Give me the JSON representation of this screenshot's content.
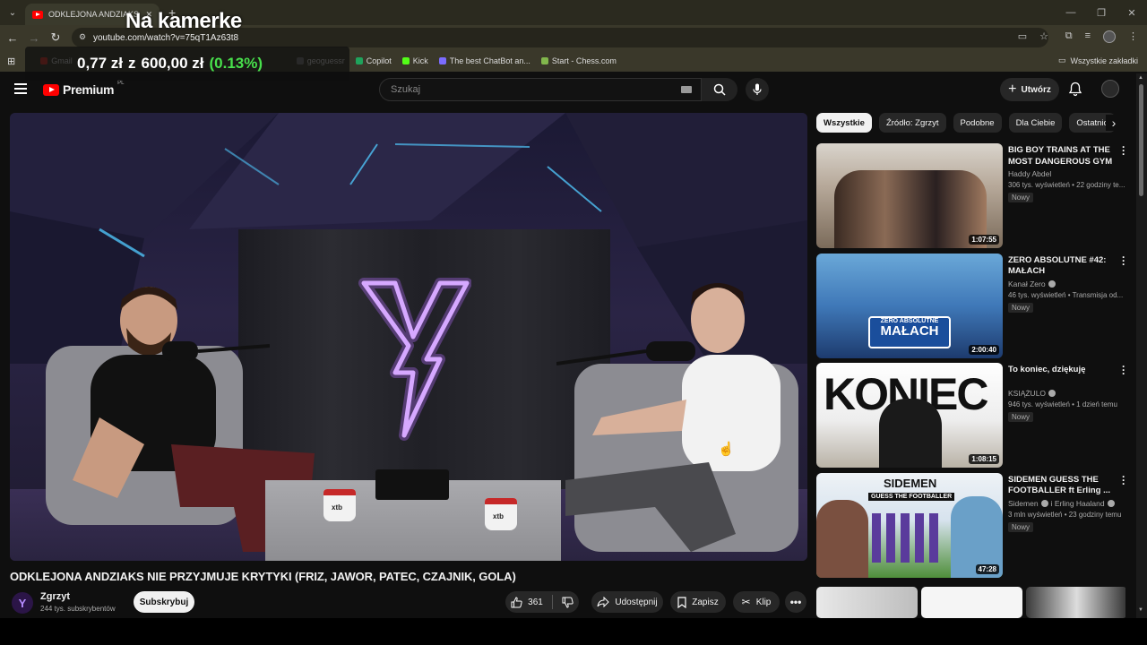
{
  "browser": {
    "tab_title": "ODKLEJONA ANDZIAKS NI",
    "url": "youtube.com/watch?v=75qT1Az63t8",
    "bookmarks": [
      {
        "label": "Gmail",
        "color": "#d93025"
      },
      {
        "label": "geoguessr",
        "color": "#777"
      },
      {
        "label": "Copilot",
        "color": "#1fa35c"
      },
      {
        "label": "Kick",
        "color": "#53fc18"
      },
      {
        "label": "The best ChatBot an...",
        "color": "#7b6cff"
      },
      {
        "label": "Start - Chess.com",
        "color": "#81b64c"
      }
    ],
    "bookmarks_folder": "Wszystkie zakładki"
  },
  "stream_overlay": {
    "camera_label": "Na kamerke",
    "price_current": "0,77 zł",
    "price_connector": "z",
    "price_target": "600,00 zł",
    "price_percent": "(0.13%)"
  },
  "youtube": {
    "logo_text": "Premium",
    "logo_region": "PL",
    "search_placeholder": "Szukaj",
    "create_label": "Utwórz"
  },
  "video": {
    "title": "ODKLEJONA ANDZIAKS NIE PRZYJMUJE KRYTYKI (FRIZ, JAWOR, PATEC, CZAJNIK, GOLA)",
    "channel_name": "Zgrzyt",
    "channel_initial": "Y",
    "channel_subs": "244 tys. subskrybentów",
    "subscribe_label": "Subskrybuj",
    "likes": "361",
    "share_label": "Udostępnij",
    "save_label": "Zapisz",
    "clip_label": "Klip",
    "mug_text": "xtb"
  },
  "sidebar": {
    "chips": [
      "Wszystkie",
      "Źródło: Zgrzyt",
      "Podobne",
      "Dla Ciebie",
      "Ostatnio"
    ],
    "recommendations": [
      {
        "title": "BIG BOY TRAINS AT THE MOST DANGEROUS GYM I...",
        "channel": "Haddy Abdel",
        "verified": false,
        "meta": "306 tys. wyświetleń • 22 godziny te...",
        "badge": "Nowy",
        "duration": "1:07:55"
      },
      {
        "title": "ZERO ABSOLUTNE #42: MAŁACH",
        "channel": "Kanał Zero",
        "verified": true,
        "meta": "46 tys. wyświetleń • Transmisja od...",
        "badge": "Nowy",
        "duration": "2:00:40",
        "thumb_text": "ZERO ABSOLUTNE",
        "thumb_name": "MAŁACH"
      },
      {
        "title": "To koniec, dziękuję",
        "channel": "KSIĄŻULO",
        "verified": true,
        "meta": "946 tys. wyświetleń • 1 dzień temu",
        "badge": "Nowy",
        "duration": "1:08:15",
        "thumb_text": "KONIEC"
      },
      {
        "title": "SIDEMEN GUESS THE FOOTBALLER ft Erling ...",
        "channel": "Sidemen",
        "channel_extra": "i Erling Haaland",
        "verified": true,
        "meta": "3 mln wyświetleń • 23 godziny temu",
        "badge": "Nowy",
        "duration": "47:28",
        "thumb_text": "SIDEMEN",
        "thumb_sub": "GUESS THE FOOTBALLER"
      }
    ]
  },
  "colors": {
    "background": "#0f0f0f",
    "youtube_red": "#ff0000",
    "overlay_green": "#48e04c",
    "chip_bg": "#272727"
  }
}
